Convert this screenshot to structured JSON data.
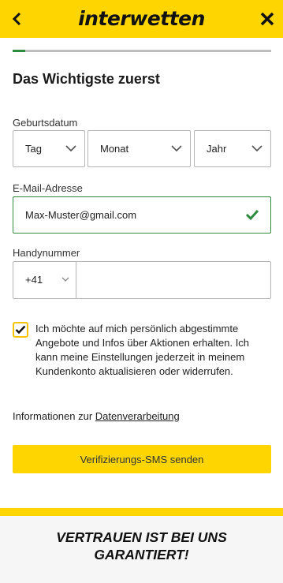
{
  "header": {
    "logo_text": "interwetten",
    "back_icon": "chevron-left-icon",
    "close_icon": "close-icon",
    "brand_color": "#ffd500"
  },
  "progress": {
    "fraction": 0.05,
    "fill_color": "#2e8b3e"
  },
  "page_title": "Das Wichtigste zuerst",
  "birthdate": {
    "label": "Geburtsdatum",
    "day_placeholder": "Tag",
    "month_placeholder": "Monat",
    "year_placeholder": "Jahr"
  },
  "email": {
    "label": "E-Mail-Adresse",
    "value": "Max-Muster@gmail.com",
    "valid_icon": "check-icon",
    "valid_color": "#2e8b3e"
  },
  "phone": {
    "label": "Handynummer",
    "prefix": "+41",
    "value": ""
  },
  "consent": {
    "checked": true,
    "text": "Ich möchte auf mich persönlich abgestimmte Angebote und Infos über Aktionen erhalten. Ich kann meine Einstellungen jederzeit in meinem Kundenkonto aktualisieren oder widerrufen."
  },
  "info": {
    "prefix": "Informationen zur ",
    "link": "Datenverarbeitung"
  },
  "submit_button": "Verifizierungs-SMS senden",
  "footer": {
    "text": "VERTRAUEN IST BEI UNS GARANTIERT!"
  }
}
